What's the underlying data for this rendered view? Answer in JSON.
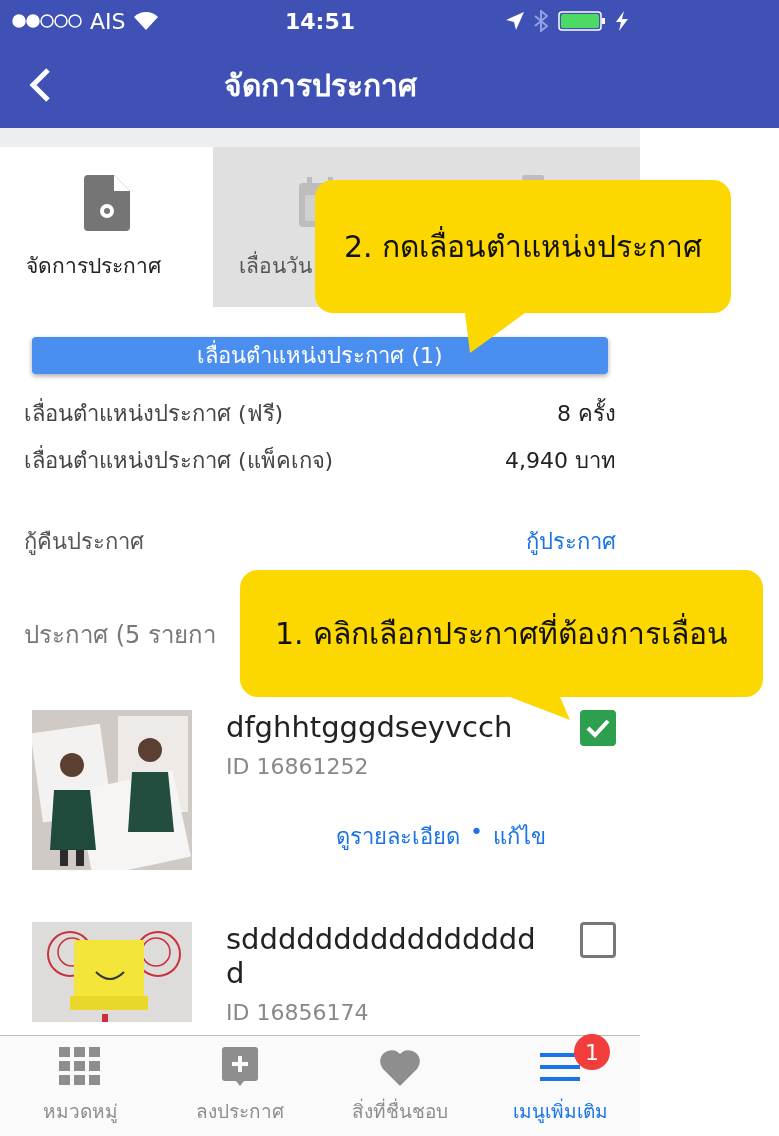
{
  "status_bar": {
    "carrier": "AIS",
    "time": "14:51"
  },
  "header": {
    "title": "จัดการประกาศ"
  },
  "tabs": [
    {
      "label": "จัดการประกาศ",
      "selected": true,
      "kind": "manage"
    },
    {
      "label": "เลื่อนวัน",
      "selected": false,
      "kind": "calendar"
    },
    {
      "selected": false,
      "kind": "clipboard"
    }
  ],
  "bump_button": {
    "label": "เลื่อนตำแหน่งประกาศ (1)"
  },
  "quota": [
    {
      "label": "เลื่อนตำแหน่งประกาศ (ฟรี)",
      "value": "8 ครั้ง"
    },
    {
      "label": "เลื่อนตำแหน่งประกาศ (แพ็คเกจ)",
      "value": "4,940 บาท"
    }
  ],
  "restore": {
    "label": "กู้คืนประกาศ",
    "link": "กู้ประกาศ"
  },
  "listings_header": "ประกาศ (5 รายกา",
  "listings": [
    {
      "title": "dfghhtgggdseyvcch",
      "id": "ID 16861252",
      "checked": true,
      "links": [
        "ดูรายละเอียด",
        "แก้ไข"
      ],
      "separator": "•"
    },
    {
      "title": "sddddddddddddddddd",
      "id": "ID 16856174",
      "checked": false
    }
  ],
  "callouts": [
    {
      "text": "2. กดเลื่อนตำแหน่งประกาศ"
    },
    {
      "text": "1. คลิกเลือกประกาศที่ต้องการเลื่อน"
    }
  ],
  "bottom_nav": [
    {
      "label": "หมวดหมู่",
      "kind": "grid",
      "selected": false
    },
    {
      "label": "ลงประกาศ",
      "kind": "post",
      "selected": false
    },
    {
      "label": "สิ่งที่ชื่นชอบ",
      "kind": "heart",
      "selected": false
    },
    {
      "label": "เมนูเพิ่มเติม",
      "kind": "menu",
      "selected": true,
      "badge": "1"
    }
  ]
}
